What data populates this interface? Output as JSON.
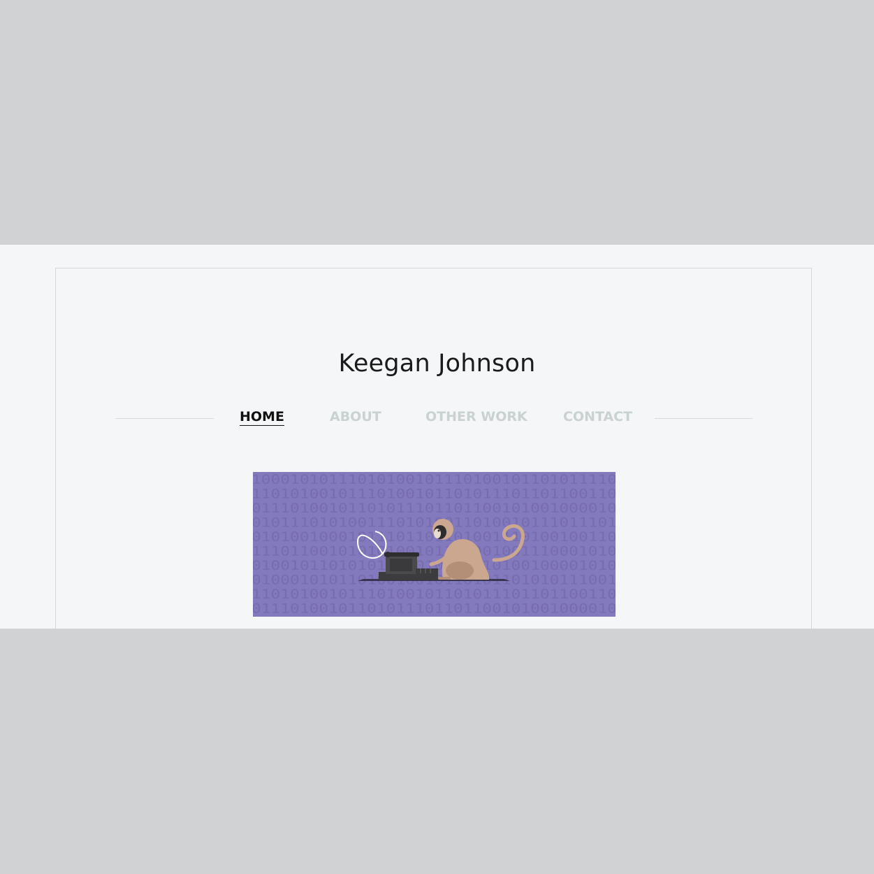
{
  "site": {
    "title": "Keegan Johnson"
  },
  "nav": {
    "items": [
      {
        "label": "HOME",
        "active": true
      },
      {
        "label": "ABOUT",
        "active": false
      },
      {
        "label": "OTHER WORK",
        "active": false
      },
      {
        "label": "CONTACT",
        "active": false
      }
    ]
  },
  "hero": {
    "illustration": "monkey-at-typewriter",
    "binary_rows": [
      "10001010111010100101110100101101011110",
      "11010100101110100101101011101101100110",
      "01110100101101011101101100101001000010",
      "01011101010011101010011010010111011101",
      "01010010001011101101101001110100100110",
      "11101100101010100101101001001110001010",
      "01001011010101010010101010100100001010",
      "01000101011010010010110101101010111001",
      "11010100101110100101101011101101100110",
      "01110100101101011101101100101001000010"
    ]
  },
  "colors": {
    "outer_background": "#d1d2d4",
    "page_background": "#f4f6f8",
    "hero_background": "#8379bd",
    "nav_inactive": "#c9d1d1",
    "nav_active": "#111111",
    "monkey": "#caa78e",
    "typewriter": "#3c3c3e"
  }
}
